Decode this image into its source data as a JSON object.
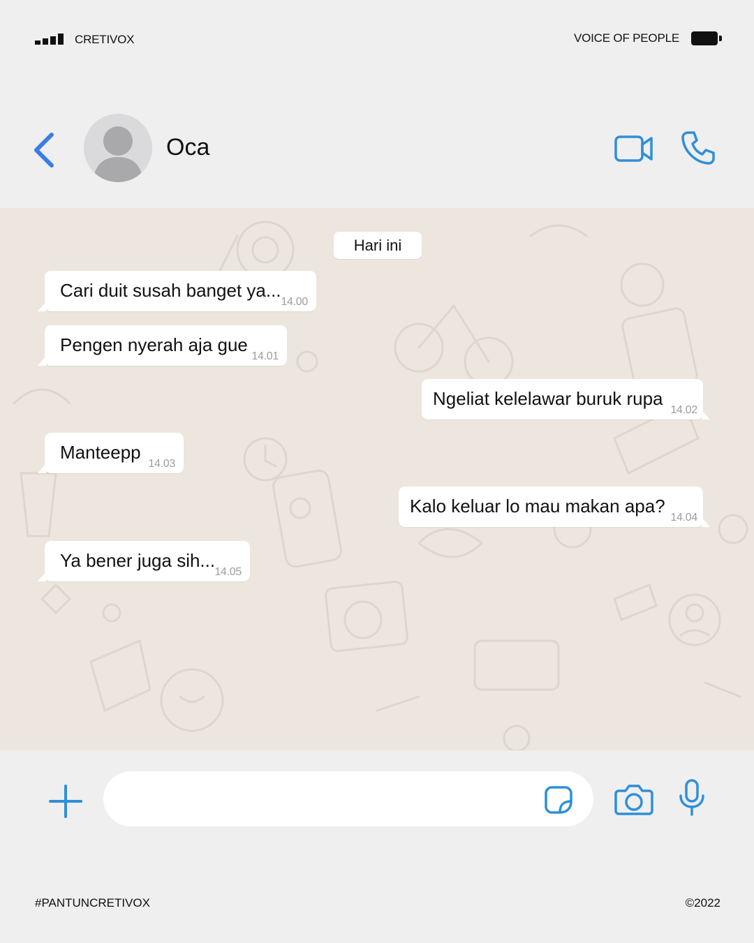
{
  "status_bar": {
    "carrier": "CRETIVOX",
    "right_text": "VOICE OF PEOPLE",
    "signal_icon": "signal-bars-icon",
    "battery_icon": "battery-full-icon"
  },
  "header": {
    "contact_name": "Oca",
    "back_icon": "chevron-left-icon",
    "video_icon": "video-camera-icon",
    "call_icon": "phone-icon",
    "avatar_icon": "default-avatar-icon"
  },
  "chat": {
    "day_label": "Hari ini",
    "messages": [
      {
        "direction": "incoming",
        "text": "Cari duit susah banget ya...",
        "time": "14.00"
      },
      {
        "direction": "incoming",
        "text": "Pengen nyerah aja gue",
        "time": "14.01"
      },
      {
        "direction": "outgoing",
        "text": "Ngeliat kelelawar buruk rupa",
        "time": "14.02"
      },
      {
        "direction": "incoming",
        "text": "Manteepp",
        "time": "14.03"
      },
      {
        "direction": "outgoing",
        "text": "Kalo keluar lo mau makan apa?",
        "time": "14.04"
      },
      {
        "direction": "incoming",
        "text": "Ya bener juga sih...",
        "time": "14.05"
      }
    ]
  },
  "input_bar": {
    "message_value": "",
    "plus_icon": "plus-icon",
    "sticker_icon": "sticker-icon",
    "camera_icon": "camera-icon",
    "mic_icon": "microphone-icon"
  },
  "footer": {
    "hashtag": "#PANTUNCRETIVOX",
    "copyright": "©2022"
  },
  "colors": {
    "accent": "#2f8fd8",
    "back_accent": "#3a7de3",
    "background": "#efefef",
    "chat_wallpaper": "#ece6de",
    "bubble": "#ffffff",
    "timestamp": "#9d9d9d"
  }
}
